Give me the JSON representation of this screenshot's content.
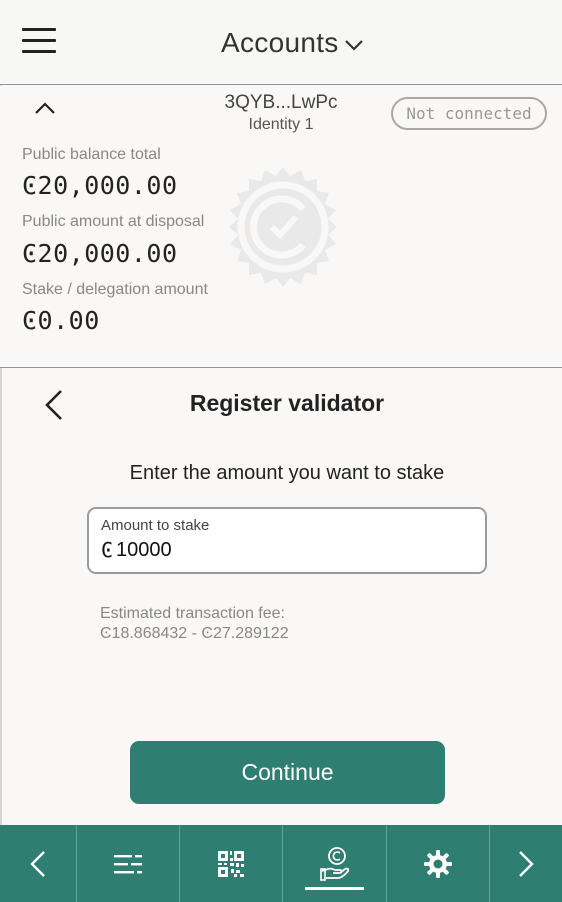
{
  "header": {
    "title": "Accounts",
    "menu_icon": "hamburger-menu-icon",
    "dropdown_icon": "chevron-down-icon"
  },
  "account": {
    "address": "3QYB...LwPc",
    "identity": "Identity 1",
    "status_badge": "Not connected",
    "public_balance_label": "Public balance total",
    "public_balance_value": "Ͼ20,000.00",
    "disposal_label": "Public amount at disposal",
    "disposal_value": "Ͼ20,000.00",
    "stake_label": "Stake / delegation amount",
    "stake_value": "Ͼ0.00"
  },
  "main": {
    "title": "Register validator",
    "prompt": "Enter the amount you want to stake",
    "amount_field": {
      "label": "Amount to stake",
      "currency_symbol": "Ͼ",
      "value": "10000"
    },
    "fee_label": "Estimated transaction fee:",
    "fee_value": "Ͼ18.868432 - Ͼ27.289122",
    "continue_label": "Continue"
  },
  "bottom_nav": {
    "items": [
      {
        "icon": "chevron-left-icon",
        "active": false
      },
      {
        "icon": "list-icon",
        "active": false
      },
      {
        "icon": "qr-code-icon",
        "active": false
      },
      {
        "icon": "stake-hand-coin-icon",
        "active": true
      },
      {
        "icon": "gear-icon",
        "active": false
      },
      {
        "icon": "chevron-right-icon",
        "active": false
      }
    ]
  },
  "colors": {
    "accent": "#2e7f71",
    "background": "#f9f8f6",
    "muted_text": "#888888"
  }
}
